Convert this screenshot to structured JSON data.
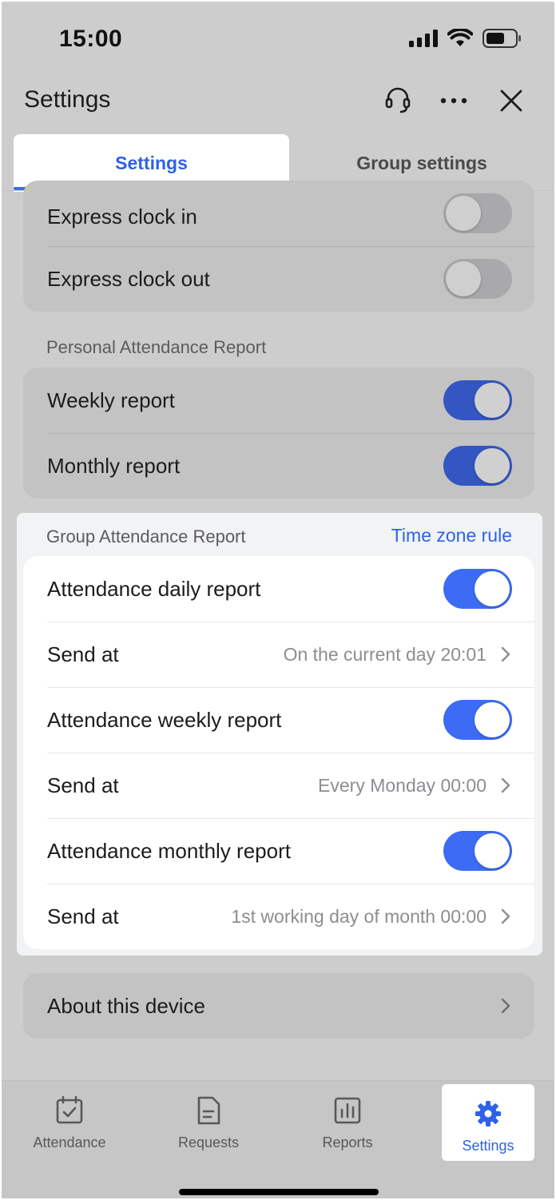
{
  "status_bar": {
    "time": "15:00",
    "icons": [
      "cellular-signal-icon",
      "wifi-icon",
      "battery-icon"
    ]
  },
  "header": {
    "title": "Settings",
    "icons": [
      "headset-support-icon",
      "more-icon",
      "close-icon"
    ]
  },
  "tabs": [
    {
      "label": "Settings",
      "active": true
    },
    {
      "label": "Group settings",
      "active": false
    }
  ],
  "express": {
    "rows": [
      {
        "label": "Express clock in",
        "toggle": false
      },
      {
        "label": "Express clock out",
        "toggle": false
      }
    ]
  },
  "personal_report": {
    "section_label": "Personal Attendance Report",
    "rows": [
      {
        "label": "Weekly report",
        "toggle": true
      },
      {
        "label": "Monthly report",
        "toggle": true
      }
    ]
  },
  "group_report": {
    "section_label": "Group Attendance Report",
    "link": "Time zone rule",
    "rows": [
      {
        "label": "Attendance daily report",
        "toggle": true
      },
      {
        "label": "Send at",
        "value": "On the current day 20:01"
      },
      {
        "label": "Attendance weekly report",
        "toggle": true
      },
      {
        "label": "Send at",
        "value": "Every Monday 00:00"
      },
      {
        "label": "Attendance monthly report",
        "toggle": true
      },
      {
        "label": "Send at",
        "value": "1st working day of month 00:00"
      }
    ]
  },
  "about": {
    "label": "About this device"
  },
  "bottom_nav": [
    {
      "label": "Attendance",
      "icon": "calendar-check-icon",
      "active": false
    },
    {
      "label": "Requests",
      "icon": "document-icon",
      "active": false
    },
    {
      "label": "Reports",
      "icon": "bar-chart-icon",
      "active": false
    },
    {
      "label": "Settings",
      "icon": "gear-icon",
      "active": true
    }
  ],
  "colors": {
    "accent": "#3d6cf4",
    "link": "#2f62e6",
    "overlay_bg": "#cdcdcd"
  }
}
